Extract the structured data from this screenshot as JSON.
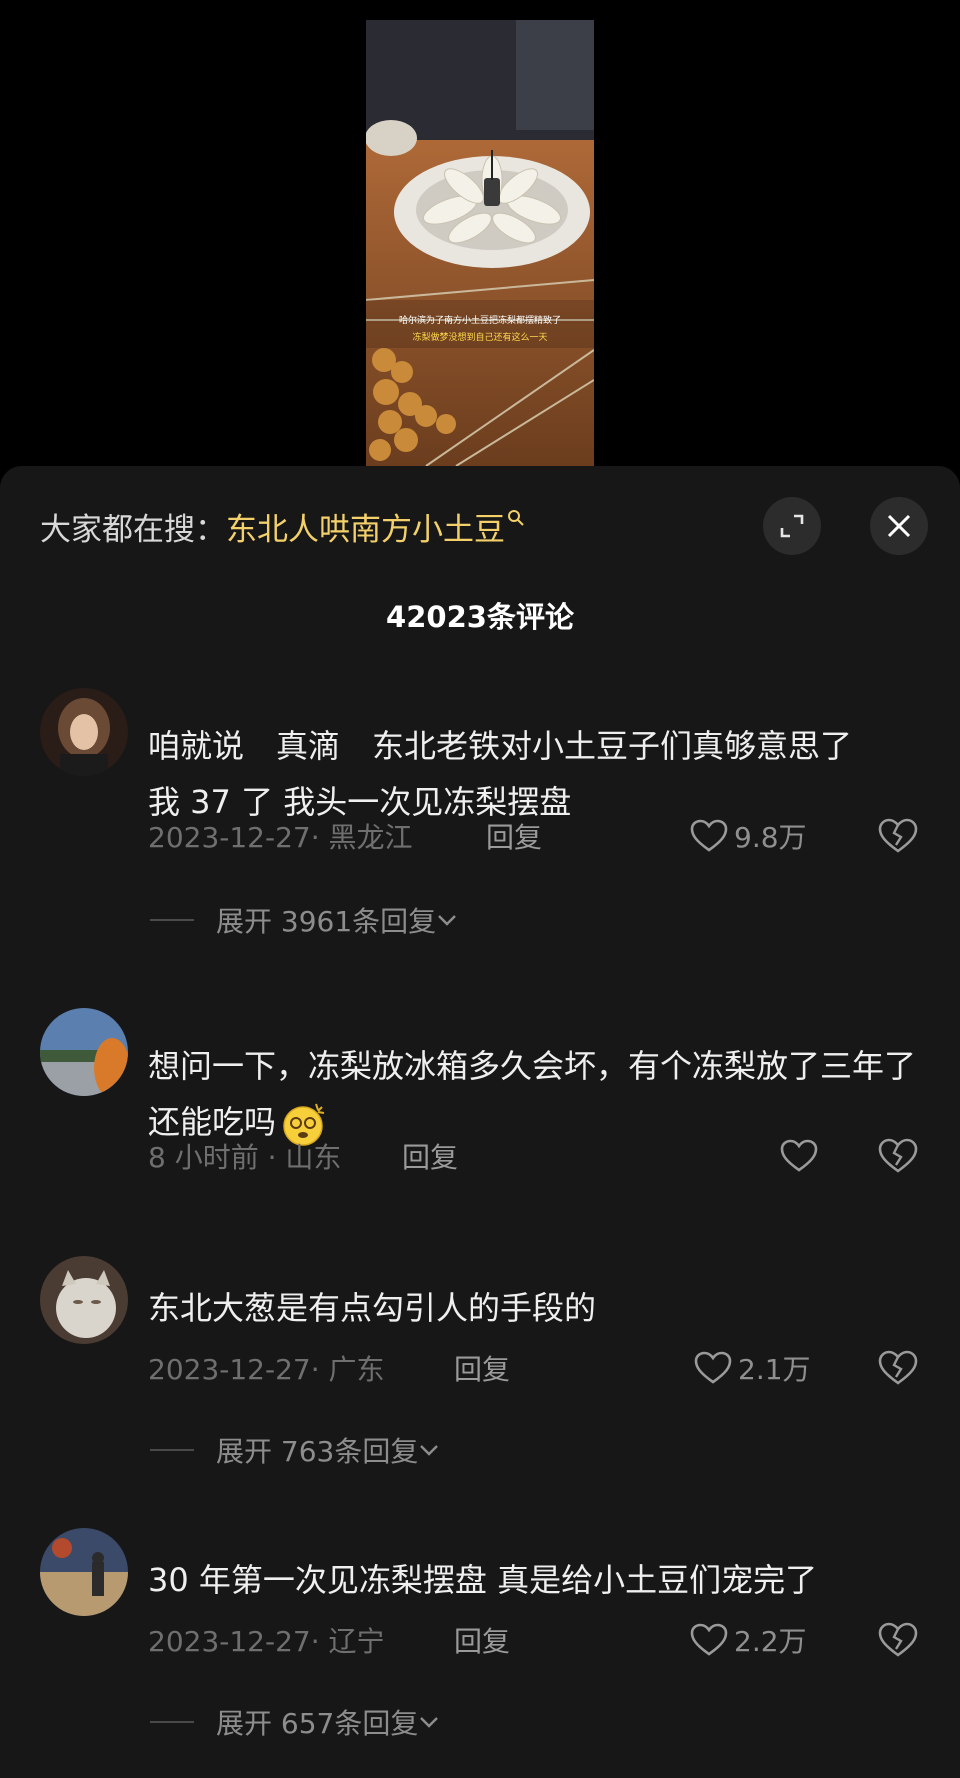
{
  "video": {
    "caption_line1": "哈尔滨为了南方小土豆把冻梨都摆精致了",
    "caption_line2": "冻梨做梦没想到自己还有这么一天"
  },
  "search": {
    "prefix": "大家都在搜：",
    "term": "东北人哄南方小土豆"
  },
  "comments_header": {
    "count_label": "42023条评论"
  },
  "comments": [
    {
      "text": "咱就说　真滴　东北老铁对小土豆子们真够意思了　 我 37 了 我头一次见冻梨摆盘",
      "meta": "2023-12-27· 黑龙江",
      "reply": "回复",
      "likes": "9.8万",
      "expand": "展开 3961条回复"
    },
    {
      "text": "想问一下，冻梨放冰箱多久会坏，有个冻梨放了三年了还能吃吗",
      "meta": "8 小时前 · 山东",
      "reply": "回复",
      "likes": ""
    },
    {
      "text": "东北大葱是有点勾引人的手段的",
      "meta": "2023-12-27· 广东",
      "reply": "回复",
      "likes": "2.1万",
      "expand": "展开 763条回复"
    },
    {
      "text": "30 年第一次见冻梨摆盘 真是给小土豆们宠完了",
      "meta": "2023-12-27· 辽宁",
      "reply": "回复",
      "likes": "2.2万",
      "expand": "展开 657条回复"
    }
  ],
  "colors": {
    "accent": "#f3d06a",
    "sheet_bg": "#171717",
    "meta": "#6f6f6f"
  },
  "icons": [
    "search-icon",
    "expand-icon",
    "close-icon",
    "heart-icon",
    "broken-heart-icon",
    "chevron-down-icon",
    "dizzy-face-emoji"
  ]
}
